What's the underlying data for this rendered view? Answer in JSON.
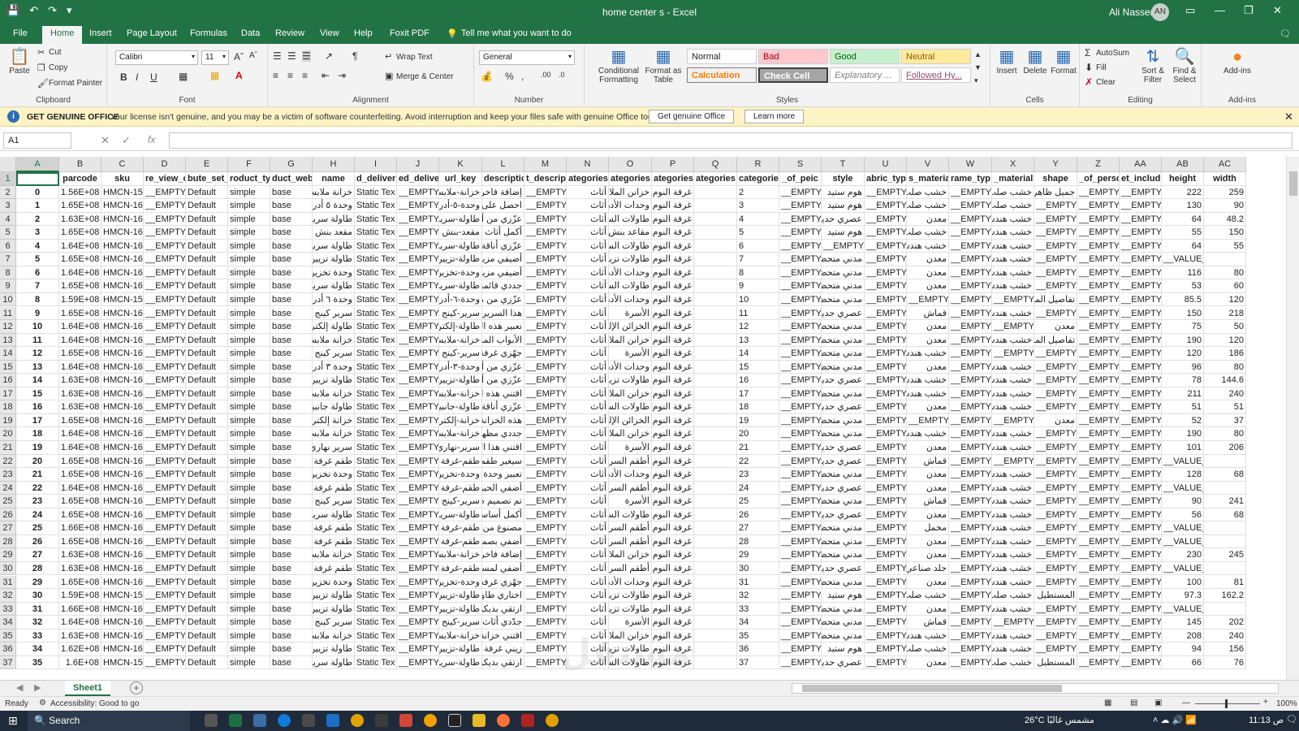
{
  "window": {
    "title": "home center s  -  Excel",
    "user": "Ali Nasser",
    "avatar": "AN"
  },
  "ribbon_tabs": [
    "File",
    "Home",
    "Insert",
    "Page Layout",
    "Formulas",
    "Data",
    "Review",
    "View",
    "Help",
    "Foxit PDF",
    "Tell me what you want to do"
  ],
  "ribbon": {
    "clipboard": {
      "paste": "Paste",
      "cut": "Cut",
      "copy": "Copy",
      "format_painter": "Format Painter",
      "label": "Clipboard"
    },
    "font": {
      "name": "Calibri",
      "size": "11",
      "label": "Font"
    },
    "alignment": {
      "wrap": "Wrap Text",
      "merge": "Merge & Center",
      "label": "Alignment"
    },
    "number": {
      "format": "General",
      "label": "Number"
    },
    "styles": {
      "conditional": "Conditional Formatting",
      "format_table": "Format as Table",
      "normal": "Normal",
      "bad": "Bad",
      "good": "Good",
      "neutral": "Neutral",
      "calculation": "Calculation",
      "check": "Check Cell",
      "explanatory": "Explanatory ...",
      "followed": "Followed Hy...",
      "label": "Styles"
    },
    "cells": {
      "insert": "Insert",
      "delete": "Delete",
      "format": "Format",
      "label": "Cells"
    },
    "editing": {
      "autosum": "AutoSum",
      "fill": "Fill",
      "clear": "Clear",
      "sort": "Sort & Filter",
      "find": "Find & Select",
      "label": "Editing"
    },
    "addins": {
      "btn": "Add-ins",
      "label": "Add-ins"
    }
  },
  "message_bar": {
    "title": "GET GENUINE OFFICE",
    "text": "Your license isn't genuine, and you may be a victim of software counterfeiting. Avoid interruption and keep your files safe with genuine Office today.",
    "btn1": "Get genuine Office",
    "btn2": "Learn more"
  },
  "formula_bar": {
    "name_box": "A1",
    "fx": "fx"
  },
  "columns": [
    "A",
    "B",
    "C",
    "D",
    "E",
    "F",
    "G",
    "H",
    "I",
    "J",
    "K",
    "L",
    "M",
    "N",
    "O",
    "P",
    "Q",
    "R",
    "S",
    "T",
    "U",
    "V",
    "W",
    "X",
    "Y",
    "Z",
    "AA",
    "AB",
    "AC"
  ],
  "header_row": [
    "",
    "parcode",
    "sku",
    "re_view_c",
    "bute_set_",
    "roduct_typ",
    "duct_webs",
    "name",
    "d_deliver",
    "ed_delive",
    "url_key",
    "descriptio",
    "t_descrip",
    "ategories",
    "ategories",
    "ategories",
    "ategories",
    "categories",
    "_of_peic",
    "style",
    "abric_typ",
    "s_materia",
    "rame_typ",
    "_material",
    "shape",
    "_of_perso",
    "et_includ",
    "height",
    "width"
  ],
  "rows": [
    {
      "r": "2",
      "a": "0",
      "b": "1.56E+08",
      "c": "HMCN-156",
      "h": "خزانة ملابس",
      "k": "خزانة-ملابس",
      "l": "إضافة فاخرة",
      "o": "خزانن الملابس",
      "p": "غرفة النوم",
      "t": "هوم ستيد",
      "v": "خشب صلب",
      "x": "خشب صلب",
      "y": "جميل ظاهر",
      "ab": "222",
      "ac": "259"
    },
    {
      "r": "3",
      "a": "1",
      "b": "1.65E+08",
      "c": "HMCN-164",
      "h": "وحدة ٥ أدراج",
      "k": "وحدة-٥-أدراج",
      "l": "احصل على أو",
      "o": "وحدات الأدراج",
      "p": "غرفة النوم",
      "t": "هوم ستيد",
      "v": "خشب صلب",
      "x": "خشب صلب",
      "y": "__EMPTY",
      "ab": "130",
      "ac": "90"
    },
    {
      "r": "4",
      "a": "2",
      "b": "1.63E+08",
      "c": "HMCN-162",
      "h": "طاولة سرير",
      "k": "طاولة-سرير",
      "l": "عزّزي من أنا",
      "o": "طاولات السرير",
      "p": "غرفة النوم",
      "t": "عصري حديث",
      "v": "معدن",
      "x": "خشب هندسي",
      "y": "__EMPTY",
      "ab": "64",
      "ac": "48.2"
    },
    {
      "r": "5",
      "a": "3",
      "b": "1.65E+08",
      "c": "HMCN-164",
      "h": "مقعد بنش",
      "k": "مقعد-بنش",
      "l": "أكمل أثاث غ",
      "o": "مقاعد بنش",
      "p": "غرفة النوم",
      "t": "هوم ستيد",
      "v": "خشب صلب",
      "x": "خشب هندسي",
      "y": "__EMPTY",
      "ab": "55",
      "ac": "150"
    },
    {
      "r": "6",
      "a": "4",
      "b": "1.64E+08",
      "c": "HMCN-163",
      "h": "طاولة سرير",
      "k": "طاولة-سرير",
      "l": "عزّزي أناقة غ",
      "o": "طاولات السرير",
      "p": "غرفة النوم",
      "t": "__EMPTY",
      "v": "خشب هندسي",
      "x": "خشب هندسي",
      "y": "__EMPTY",
      "ab": "64",
      "ac": "55"
    },
    {
      "r": "7",
      "a": "5",
      "b": "1.65E+08",
      "c": "HMCN-164",
      "h": "طاولة تزيين",
      "k": "طاولة-تزيين",
      "l": "أضيفي مزيدا",
      "o": "طاولات تزيين",
      "p": "غرفة النوم",
      "t": "مدني متحضر",
      "v": "معدن",
      "x": "خشب هندسي",
      "y": "__EMPTY",
      "ab": "__VALUE__",
      "ac": ""
    },
    {
      "r": "8",
      "a": "6",
      "b": "1.64E+08",
      "c": "HMCN-163",
      "h": "وحدة تخزين",
      "k": "وحدة-تخزين",
      "l": "أضيفي مزيدا",
      "o": "وحدات الأدراج",
      "p": "غرفة النوم",
      "t": "مدني متحضر",
      "v": "معدن",
      "x": "خشب هندسي",
      "y": "__EMPTY",
      "ab": "116",
      "ac": "80"
    },
    {
      "r": "9",
      "a": "7",
      "b": "1.65E+08",
      "c": "HMCN-164",
      "h": "طاولة سرير",
      "k": "طاولة-سرير",
      "l": "جددي قائمة",
      "o": "طاولات السرير",
      "p": "غرفة النوم",
      "t": "مدني متحضر",
      "v": "معدن",
      "x": "خشب هندسي",
      "y": "__EMPTY",
      "ab": "53",
      "ac": "60"
    },
    {
      "r": "10",
      "a": "8",
      "b": "1.59E+08",
      "c": "HMCN-158",
      "h": "وحدة ٦ أدراج",
      "k": "وحدة-٦-أدراج",
      "l": "عزّزي من مس",
      "o": "وحدات الأدراج",
      "p": "غرفة النوم",
      "t": "مدني متحضر",
      "v": "__EMPTY",
      "x": "__EMPTY",
      "y": "تفاصيل المنتج الواح ليقية ما",
      "ab": "85.5",
      "ac": "120"
    },
    {
      "r": "11",
      "a": "9",
      "b": "1.65E+08",
      "c": "HMCN-164",
      "h": "سرير كينج",
      "k": "سرير-كينج",
      "l": "هذا السرير بـ",
      "o": "الأسرة",
      "p": "غرفة النوم",
      "t": "عصري حديث",
      "v": "قماش",
      "x": "خشب هندسي",
      "y": "__EMPTY",
      "ab": "150",
      "ac": "218"
    },
    {
      "r": "12",
      "a": "10",
      "b": "1.64E+08",
      "c": "HMCN-163",
      "h": "طاولة إلكترونية",
      "k": "طاولة-إلكترونية",
      "l": "تعبير هذه ال",
      "o": "الخزائن الإلكترونية",
      "p": "غرفة النوم",
      "t": "مدني متحضر",
      "v": "معدن",
      "x": "__EMPTY",
      "y": "معدن",
      "ab": "75",
      "ac": "50"
    },
    {
      "r": "13",
      "a": "11",
      "b": "1.64E+08",
      "c": "HMCN-163",
      "h": "خزانة ملابس",
      "k": "خزانة-ملابس",
      "l": "الأبواب المزد",
      "o": "خزانن الملابس",
      "p": "غرفة النوم",
      "t": "مدني متحضر",
      "v": "معدن",
      "x": "خشب هندسي",
      "y": "تفاصيل المنتج",
      "ab": "190",
      "ac": "120"
    },
    {
      "r": "14",
      "a": "12",
      "b": "1.65E+08",
      "c": "HMCN-164",
      "h": "سرير كينج",
      "k": "سرير-كينج",
      "l": "جهّزي غرفة",
      "o": "الأسرة",
      "p": "غرفة النوم",
      "t": "مدني متحضر",
      "v": "خشب هندسي",
      "x": "__EMPTY",
      "y": "__EMPTY",
      "ab": "120",
      "ac": "186"
    },
    {
      "r": "15",
      "a": "13",
      "b": "1.64E+08",
      "c": "HMCN-163",
      "h": "وحدة ٣ أدراج",
      "k": "وحدة-٣-أدراج",
      "l": "عزّزي من أنا",
      "o": "وحدات الأدراج",
      "p": "غرفة النوم",
      "t": "مدني متحضر",
      "v": "معدن",
      "x": "خشب هندسي",
      "y": "__EMPTY",
      "ab": "96",
      "ac": "80"
    },
    {
      "r": "16",
      "a": "14",
      "b": "1.63E+08",
      "c": "HMCN-162",
      "h": "طاولة تزيين",
      "k": "طاولة-تزيين",
      "l": "عزّزي من أنا",
      "o": "طاولات تزيين",
      "p": "غرفة النوم",
      "t": "عصري حديث",
      "v": "خشب هندسي",
      "x": "خشب هندسي",
      "y": "__EMPTY",
      "ab": "78",
      "ac": "144.6"
    },
    {
      "r": "17",
      "a": "15",
      "b": "1.63E+08",
      "c": "HMCN-162",
      "h": "خزانة ملابس",
      "k": "خزانة-ملابس",
      "l": "اقتني هذه ال",
      "o": "خزانن الملابس",
      "p": "غرفة النوم",
      "t": "مدني متحضر",
      "v": "خشب هندسي",
      "x": "خشب هندسي",
      "y": "__EMPTY",
      "ab": "211",
      "ac": "240"
    },
    {
      "r": "18",
      "a": "16",
      "b": "1.63E+08",
      "c": "HMCN-162",
      "h": "طاولة جانبية",
      "k": "طاولة-جانبية",
      "l": "عزّزي أناقة غ",
      "o": "طاولات السرير",
      "p": "غرفة النوم",
      "t": "عصري حديث",
      "v": "معدن",
      "x": "خشب هندسي",
      "y": "__EMPTY",
      "ab": "51",
      "ac": "51"
    },
    {
      "r": "19",
      "a": "17",
      "b": "1.65E+08",
      "c": "HMCN-164",
      "h": "خزانة إلكترونية",
      "k": "خزانة-إلكترونية",
      "l": "هذه الخزانة",
      "o": "الخزائن الإلكترونية",
      "p": "غرفة النوم",
      "t": "مدني متحضر",
      "v": "__EMPTY",
      "x": "__EMPTY",
      "y": "معدن",
      "ab": "52",
      "ac": "37"
    },
    {
      "r": "20",
      "a": "18",
      "b": "1.64E+08",
      "c": "HMCN-163",
      "h": "خزانة ملابس",
      "k": "خزانة-ملابس",
      "l": "جددي مظهر",
      "o": "خزانن الملابس",
      "p": "غرفة النوم",
      "t": "مدني متحضر",
      "v": "خشب هندسي",
      "x": "خشب هندسي",
      "y": "__EMPTY",
      "ab": "190",
      "ac": "80"
    },
    {
      "r": "21",
      "a": "19",
      "b": "1.64E+08",
      "c": "HMCN-163",
      "h": "سرير نهاري",
      "k": "سرير-نهاري",
      "l": "اقتني هذا ال",
      "o": "الأسرة",
      "p": "غرفة النوم",
      "t": "عصري حديث",
      "v": "معدن",
      "x": "خشب هندسي",
      "y": "__EMPTY",
      "ab": "101",
      "ac": "206"
    },
    {
      "r": "22",
      "a": "20",
      "b": "1.65E+08",
      "c": "HMCN-165",
      "h": "طقم غرفة نوم",
      "k": "طقم-غرفة",
      "l": "سيغير طقم",
      "o": "أطقم السرير",
      "p": "غرفة النوم",
      "t": "عصري حديث",
      "v": "قماش",
      "x": "__EMPTY",
      "y": "__EMPTY",
      "ab": "__VALUE__",
      "ac": ""
    },
    {
      "r": "23",
      "a": "21",
      "b": "1.65E+08",
      "c": "HMCN-164",
      "h": "وحدة تخزين",
      "k": "وحدة-تخزين",
      "l": "تعبير وحدة ا",
      "o": "وحدات الأدراج",
      "p": "غرفة النوم",
      "t": "مدني متحضر",
      "v": "معدن",
      "x": "خشب هندسي",
      "y": "__EMPTY",
      "ab": "128",
      "ac": "68"
    },
    {
      "r": "24",
      "a": "22",
      "b": "1.64E+08",
      "c": "HMCN-163",
      "h": "طقم غرفة نوم",
      "k": "طقم-غرفة",
      "l": "أضفي الحيوي",
      "o": "أطقم السرير",
      "p": "غرفة النوم",
      "t": "عصري حديث",
      "v": "معدن",
      "x": "خشب هندسي",
      "y": "__EMPTY",
      "ab": "__VALUE__",
      "ac": ""
    },
    {
      "r": "25",
      "a": "23",
      "b": "1.65E+08",
      "c": "HMCN-164",
      "h": "سرير كينج",
      "k": "سرير-كينج",
      "l": "تم تصميم ه",
      "o": "الأسرة",
      "p": "غرفة النوم",
      "t": "مدني متحضر",
      "v": "قماش",
      "x": "خشب هندسي",
      "y": "__EMPTY",
      "ab": "90",
      "ac": "241"
    },
    {
      "r": "26",
      "a": "24",
      "b": "1.65E+08",
      "c": "HMCN-164",
      "h": "طاولة سرير",
      "k": "طاولة-سرير",
      "l": "أكمل أساسيا",
      "o": "طاولات السرير",
      "p": "غرفة النوم",
      "t": "عصري حديث",
      "v": "معدن",
      "x": "خشب هندسي",
      "y": "__EMPTY",
      "ab": "56",
      "ac": "68"
    },
    {
      "r": "27",
      "a": "25",
      "b": "1.66E+08",
      "c": "HMCN-165",
      "h": "طقم غرفة نوم",
      "k": "طقم-غرفة",
      "l": "مصنوع من ال",
      "o": "أطقم السرير",
      "p": "غرفة النوم",
      "t": "مدني متحضر",
      "v": "مخمل",
      "x": "خشب هندسي",
      "y": "__EMPTY",
      "ab": "__VALUE__",
      "ac": ""
    },
    {
      "r": "28",
      "a": "26",
      "b": "1.65E+08",
      "c": "HMCN-164",
      "h": "طقم غرفة نوم",
      "k": "طقم-غرفة",
      "l": "أضفي بصمة",
      "o": "أطقم السرير",
      "p": "غرفة النوم",
      "t": "مدني متحضر",
      "v": "معدن",
      "x": "خشب هندسي",
      "y": "__EMPTY",
      "ab": "__VALUE__",
      "ac": ""
    },
    {
      "r": "29",
      "a": "27",
      "b": "1.63E+08",
      "c": "HMCN-162",
      "h": "خزانة ملابس",
      "k": "خزانة-ملابس",
      "l": "إضافة فاخرة",
      "o": "خزانن الملابس",
      "p": "غرفة النوم",
      "t": "مدني متحضر",
      "v": "معدن",
      "x": "خشب هندسي",
      "y": "__EMPTY",
      "ab": "230",
      "ac": "245"
    },
    {
      "r": "30",
      "a": "28",
      "b": "1.63E+08",
      "c": "HMCN-162",
      "h": "طقم غرفة نوم",
      "k": "طقم-غرفة",
      "l": "أضفي لمسة",
      "o": "أطقم السرير",
      "p": "غرفة النوم",
      "t": "عصري حديث",
      "v": "جلد صناعي",
      "x": "خشب هندسي",
      "y": "__EMPTY",
      "ab": "__VALUE__",
      "ac": ""
    },
    {
      "r": "31",
      "a": "29",
      "b": "1.65E+08",
      "c": "HMCN-164",
      "h": "وحدة تخزين",
      "k": "وحدة-تخزين",
      "l": "جهّزي غرفة",
      "o": "وحدات الأدراج",
      "p": "غرفة النوم",
      "t": "مدني متحضر",
      "v": "معدن",
      "x": "خشب هندسي",
      "y": "__EMPTY",
      "ab": "100",
      "ac": "81"
    },
    {
      "r": "32",
      "a": "30",
      "b": "1.59E+08",
      "c": "HMCN-158",
      "h": "طاولة تزيين",
      "k": "طاولة-تزيين",
      "l": "اختاري طاولة",
      "o": "طاولات تزيين",
      "p": "غرفة النوم",
      "t": "هوم ستيد",
      "v": "خشب صلب",
      "x": "خشب صلب",
      "y": "المستطيل",
      "ab": "97.3",
      "ac": "162.2"
    },
    {
      "r": "33",
      "a": "31",
      "b": "1.66E+08",
      "c": "HMCN-165",
      "h": "طاولة تزيين",
      "k": "طاولة-تزيين",
      "l": "ارتقي بديكور",
      "o": "طاولات تزيين",
      "p": "غرفة النوم",
      "t": "مدني متحضر",
      "v": "معدن",
      "x": "خشب هندسي",
      "y": "__EMPTY",
      "ab": "__VALUE__",
      "ac": ""
    },
    {
      "r": "34",
      "a": "32",
      "b": "1.64E+08",
      "c": "HMCN-163",
      "h": "سرير كينج",
      "k": "سرير-كينج",
      "l": "جدّدي أثاث",
      "o": "الأسرة",
      "p": "غرفة النوم",
      "t": "مدني متحضر",
      "v": "قماش",
      "x": "__EMPTY",
      "y": "__EMPTY",
      "ab": "145",
      "ac": "202"
    },
    {
      "r": "35",
      "a": "33",
      "b": "1.63E+08",
      "c": "HMCN-162",
      "h": "خزانة ملابس",
      "k": "خزانة-ملابس",
      "l": "اقتني خزانة",
      "o": "خزانن الملابس",
      "p": "غرفة النوم",
      "t": "مدني متحضر",
      "v": "خشب هندسي",
      "x": "خشب هندسي",
      "y": "__EMPTY",
      "ab": "208",
      "ac": "240"
    },
    {
      "r": "36",
      "a": "34",
      "b": "1.62E+08",
      "c": "HMCN-162",
      "h": "طاولة تزيين",
      "k": "طاولة-تزيين",
      "l": "زيني غرفة نو",
      "o": "طاولات تزيين",
      "p": "غرفة النوم",
      "t": "هوم ستيد",
      "v": "خشب صلب",
      "x": "خشب هندسي",
      "y": "__EMPTY",
      "ab": "94",
      "ac": "156"
    },
    {
      "r": "37",
      "a": "35",
      "b": "1.6E+08",
      "c": "HMCN-159",
      "h": "طاولة سرير",
      "k": "طاولة-سرير",
      "l": "ارتقي بديكور",
      "o": "طاولات السرير",
      "p": "غرفة النوم",
      "t": "عصري حديث",
      "v": "معدن",
      "x": "خشب صلب",
      "y": "المستطيل",
      "ab": "66",
      "ac": "76"
    }
  ],
  "common_values": {
    "empty": "__EMPTY",
    "default": "Default",
    "simple": "simple",
    "base": "base",
    "static": "Static Tex",
    "athath": "أثاث"
  },
  "sheet": {
    "name": "Sheet1"
  },
  "status": {
    "ready": "Ready",
    "accessibility": "Accessibility: Good to go",
    "zoom": "100%"
  },
  "taskbar": {
    "search": "Search",
    "weather": "26°C  مشمس غالبًا",
    "time": "11:13 ص"
  },
  "watermark": {
    "ar": "مستقل",
    "en": "mostaql.com"
  }
}
